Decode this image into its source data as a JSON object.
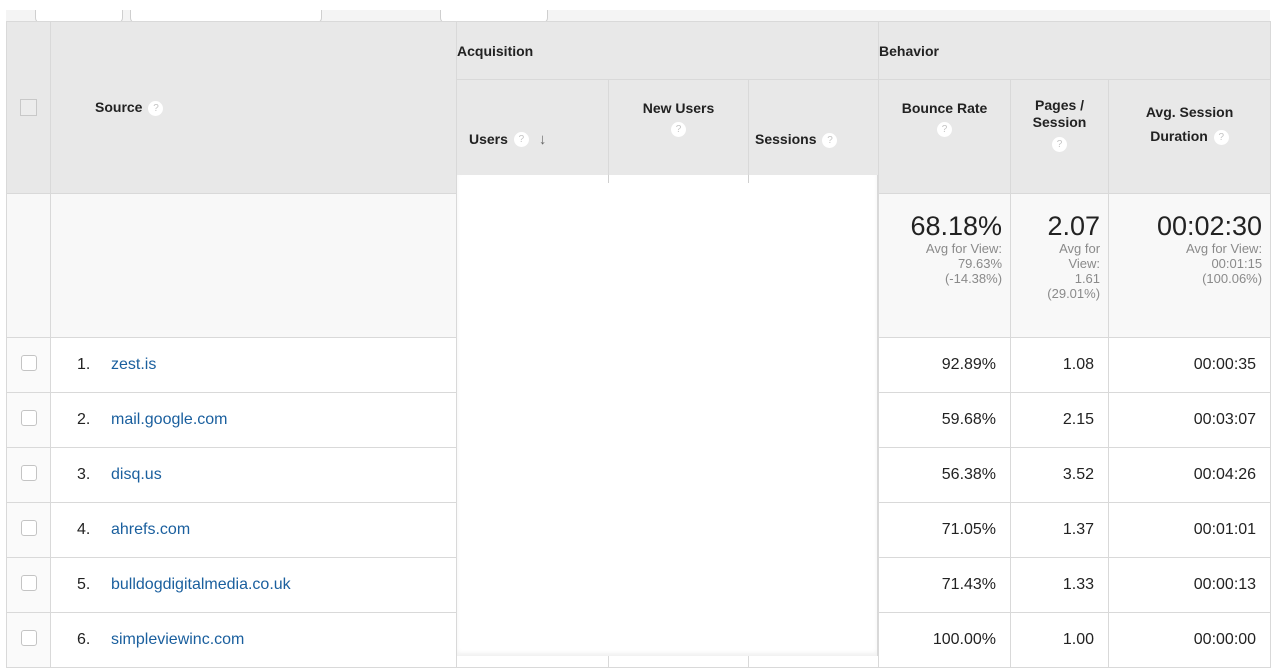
{
  "toolbar": {
    "buttons": [
      {
        "name": "toolbar-button-1",
        "label": ""
      },
      {
        "name": "toolbar-button-2",
        "label": ""
      },
      {
        "name": "toolbar-button-3",
        "label": ""
      }
    ]
  },
  "table": {
    "header": {
      "select_all_label": "",
      "source_label": "Source",
      "groups": {
        "acquisition": "Acquisition",
        "behavior": "Behavior"
      },
      "columns": {
        "users": "Users",
        "new_users": "New Users",
        "sessions": "Sessions",
        "bounce_rate": "Bounce Rate",
        "pages_session_line1": "Pages /",
        "pages_session_line2": "Session",
        "avg_duration_line1": "Avg. Session",
        "avg_duration_line2": "Duration"
      },
      "help_glyph": "?",
      "sort_glyph": "↓"
    },
    "summary": {
      "bounce_rate": {
        "value": "68.18%",
        "avg_line1": "Avg for View:",
        "avg_line2": "79.63%",
        "delta": "(-14.38%)"
      },
      "pages_session": {
        "value": "2.07",
        "avg_line1": "Avg for",
        "avg_line2": "View:",
        "avg_line3": "1.61",
        "delta": "(29.01%)"
      },
      "avg_duration": {
        "value": "00:02:30",
        "avg_line1": "Avg for View:",
        "avg_line2": "00:01:15",
        "delta": "(100.06%)"
      }
    },
    "rows": [
      {
        "rank": "1.",
        "source": "zest.is",
        "bounce_rate": "92.89%",
        "pages_session": "1.08",
        "avg_duration": "00:00:35"
      },
      {
        "rank": "2.",
        "source": "mail.google.com",
        "bounce_rate": "59.68%",
        "pages_session": "2.15",
        "avg_duration": "00:03:07"
      },
      {
        "rank": "3.",
        "source": "disq.us",
        "bounce_rate": "56.38%",
        "pages_session": "3.52",
        "avg_duration": "00:04:26"
      },
      {
        "rank": "4.",
        "source": "ahrefs.com",
        "bounce_rate": "71.05%",
        "pages_session": "1.37",
        "avg_duration": "00:01:01"
      },
      {
        "rank": "5.",
        "source": "bulldogdigitalmedia.co.uk",
        "bounce_rate": "71.43%",
        "pages_session": "1.33",
        "avg_duration": "00:00:13"
      },
      {
        "rank": "6.",
        "source": "simpleviewinc.com",
        "bounce_rate": "100.00%",
        "pages_session": "1.00",
        "avg_duration": "00:00:00"
      }
    ]
  },
  "colors": {
    "link": "#1a5f9e",
    "header_bg": "#e8e8e8",
    "summary_bg": "#f8f8f8",
    "border": "#d9d9d9",
    "muted_text": "#8a8a8a"
  }
}
